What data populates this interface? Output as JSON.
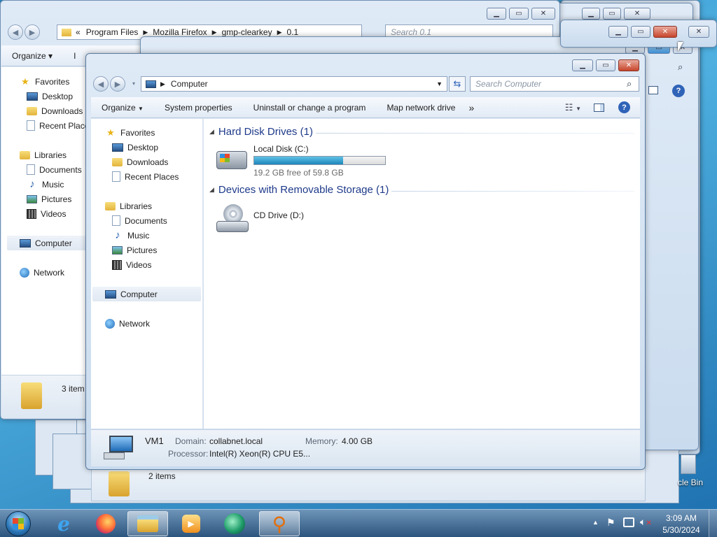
{
  "back_window_1": {
    "breadcrumb": [
      "«",
      "Program Files",
      "Mozilla Firefox",
      "gmp-clearkey",
      "0.1"
    ],
    "search_placeholder": "Search 0.1",
    "toolbar": {
      "organize": "Organize ▾",
      "include": "I"
    },
    "nav": {
      "favorites": "Favorites",
      "desktop": "Desktop",
      "downloads": "Downloads",
      "recent": "Recent Places",
      "libraries": "Libraries",
      "documents": "Documents",
      "music": "Music",
      "pictures": "Pictures",
      "videos": "Videos",
      "computer": "Computer",
      "network": "Network"
    },
    "status": "3 item"
  },
  "back_window_2": {
    "status": "2 items"
  },
  "desktop": {
    "recycle_bin_label": "cle Bin"
  },
  "main_window": {
    "address": "Computer",
    "search_placeholder": "Search Computer",
    "toolbar": {
      "organize": "Organize",
      "system_properties": "System properties",
      "uninstall": "Uninstall or change a program",
      "map_drive": "Map network drive",
      "more": "»"
    },
    "nav": {
      "favorites": "Favorites",
      "desktop": "Desktop",
      "downloads": "Downloads",
      "recent": "Recent Places",
      "libraries": "Libraries",
      "documents": "Documents",
      "music": "Music",
      "pictures": "Pictures",
      "videos": "Videos",
      "computer": "Computer",
      "network": "Network"
    },
    "groups": {
      "hard_disks": "Hard Disk Drives (1)",
      "removable": "Devices with Removable Storage (1)"
    },
    "local_disk": {
      "name": "Local Disk (C:)",
      "free_text": "19.2 GB free of 59.8 GB",
      "used_fraction": 0.68
    },
    "cd_drive": {
      "name": "CD Drive (D:)"
    },
    "details": {
      "computer_name": "VM1",
      "domain_label": "Domain:",
      "domain_value": "collabnet.local",
      "memory_label": "Memory:",
      "memory_value": "4.00 GB",
      "processor_label": "Processor:",
      "processor_value": "Intel(R) Xeon(R) CPU E5..."
    }
  },
  "taskbar": {
    "apps": [
      "start-orb",
      "internet-explorer",
      "firefox",
      "windows-explorer",
      "media-player",
      "app-icon",
      "search-app"
    ],
    "clock_time": "3:09 AM",
    "clock_date": "5/30/2024",
    "tray_overflow": "▲"
  }
}
